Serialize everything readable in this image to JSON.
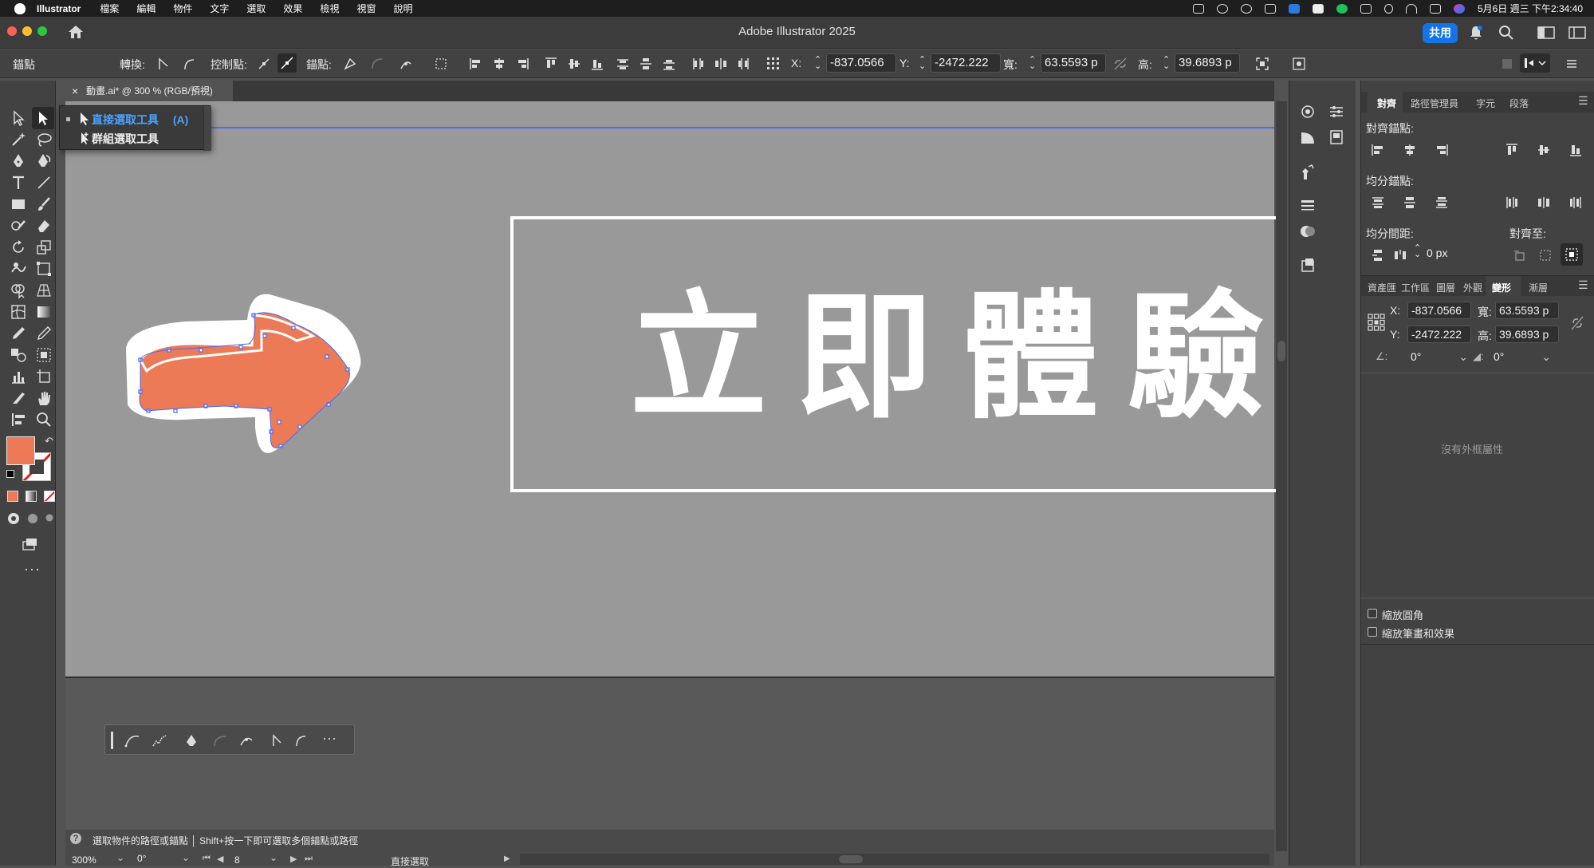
{
  "menubar": {
    "app_name": "Illustrator",
    "items": [
      "檔案",
      "編輯",
      "物件",
      "文字",
      "選取",
      "效果",
      "檢視",
      "視窗",
      "說明"
    ],
    "clock": "5月6日 週三 下午2:34:40"
  },
  "window": {
    "title": "Adobe Illustrator 2025",
    "share_label": "共用"
  },
  "controlbar": {
    "mode_label": "錨點",
    "convert_label": "轉換:",
    "handles_label": "控制點:",
    "anchors_label": "錨點:",
    "x_label": "X:",
    "x_value": "-837.0566",
    "y_label": "Y:",
    "y_value": "-2472.222",
    "w_label": "寬:",
    "w_value": "63.5593 p",
    "h_label": "高:",
    "h_value": "39.6893 p"
  },
  "document_tab": {
    "close": "×",
    "name": "動畫.ai* @ 300 % (RGB/預視)"
  },
  "flyout": {
    "items": [
      {
        "label": "直接選取工具",
        "shortcut": "(A)",
        "active": true
      },
      {
        "label": "群組選取工具",
        "shortcut": "",
        "active": false
      }
    ]
  },
  "artwork": {
    "headline": "立即體驗",
    "arrow_color": "#ec7a56",
    "frame_color": "#ffffff"
  },
  "colors": {
    "fill": "#ec7a56",
    "canvas": "#999999",
    "accent": "#1473e6",
    "selection": "#4a6cf7"
  },
  "panels": {
    "align_tabs": [
      "對齊",
      "路徑管理員",
      "字元",
      "段落"
    ],
    "align_anchor_label": "對齊錨點:",
    "distribute_anchor_label": "均分錨點:",
    "distribute_spacing_label": "均分間距:",
    "align_to_label": "對齊至:",
    "spacing_value": "0 px",
    "transform_tabs": [
      "資產匯",
      "工作區",
      "圖層",
      "外觀",
      "變形",
      "漸層"
    ],
    "transform": {
      "x_label": "X:",
      "x": "-837.0566",
      "y_label": "Y:",
      "y": "-2472.222",
      "w_label": "寬:",
      "w": "63.5593 p",
      "h_label": "高:",
      "h": "39.6893 p",
      "rotate": "0°",
      "shear": "0°"
    },
    "no_frame_text": "沒有外框屬性",
    "scale_corners": "縮放圓角",
    "scale_strokes": "縮放筆畫和效果"
  },
  "status": {
    "hint": "選取物件的路徑或錨點 │ Shift+按一下即可選取多個錨點或路徑",
    "zoom": "300%",
    "rotation": "0°",
    "artboard": "8",
    "tool": "直接選取"
  }
}
